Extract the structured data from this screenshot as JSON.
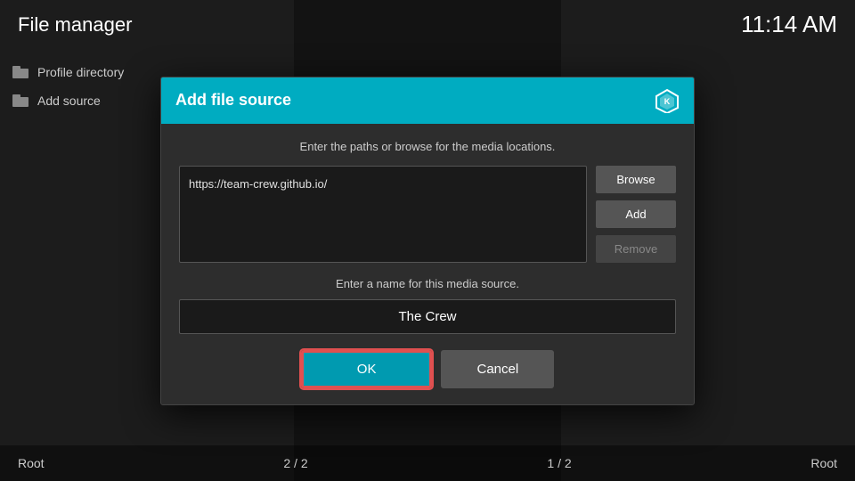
{
  "header": {
    "title": "File manager",
    "time": "11:14 AM"
  },
  "sidebar": {
    "items": [
      {
        "label": "Profile directory",
        "icon": "folder-icon"
      },
      {
        "label": "Add source",
        "icon": "folder-icon"
      }
    ]
  },
  "footer": {
    "left": "Root",
    "center_left": "2 / 2",
    "center_right": "1 / 2",
    "right": "Root"
  },
  "modal": {
    "title": "Add file source",
    "instruction_paths": "Enter the paths or browse for the media locations.",
    "url_value": "https://team-crew.github.io/",
    "btn_browse": "Browse",
    "btn_add": "Add",
    "btn_remove": "Remove",
    "instruction_name": "Enter a name for this media source.",
    "name_value": "The Crew",
    "btn_ok": "OK",
    "btn_cancel": "Cancel"
  }
}
